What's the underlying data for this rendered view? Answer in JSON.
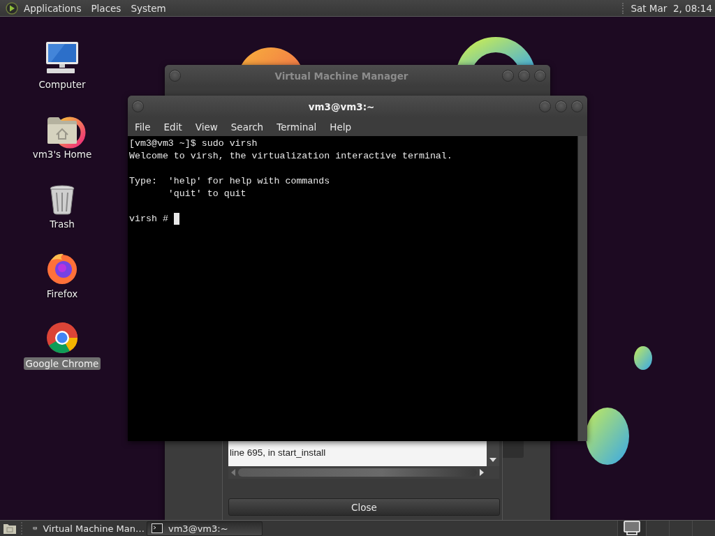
{
  "top_panel": {
    "menus": [
      {
        "label": "Applications"
      },
      {
        "label": "Places"
      },
      {
        "label": "System"
      }
    ],
    "clock": "Sat Mar  2, 08:14"
  },
  "desktop_icons": [
    {
      "label": "Computer",
      "kind": "computer",
      "selected": false
    },
    {
      "label": "vm3's Home",
      "kind": "home",
      "selected": false
    },
    {
      "label": "Trash",
      "kind": "trash",
      "selected": false
    },
    {
      "label": "Firefox",
      "kind": "firefox",
      "selected": false
    },
    {
      "label": "Google Chrome",
      "kind": "chrome",
      "selected": true
    }
  ],
  "vmm_window": {
    "title": "Virtual Machine Manager",
    "active": false
  },
  "error_dialog": {
    "text_lines": [
      "line 695, in start_install"
    ],
    "button": "Close"
  },
  "terminal": {
    "title": "vm3@vm3:~",
    "active": true,
    "menus": [
      {
        "label": "File"
      },
      {
        "label": "Edit"
      },
      {
        "label": "View"
      },
      {
        "label": "Search"
      },
      {
        "label": "Terminal"
      },
      {
        "label": "Help"
      }
    ],
    "lines": [
      {
        "text": "[vm3@vm3 ~]$ sudo virsh",
        "gap_before": false,
        "cursor": false
      },
      {
        "text": "Welcome to virsh, the virtualization interactive terminal.",
        "gap_before": false,
        "cursor": false
      },
      {
        "text": "Type:  'help' for help with commands",
        "gap_before": true,
        "cursor": false
      },
      {
        "text": "       'quit' to quit",
        "gap_before": false,
        "cursor": false
      },
      {
        "text": "virsh # ",
        "gap_before": true,
        "cursor": true
      }
    ]
  },
  "taskbar": {
    "tasks": [
      {
        "label": "Virtual Machine Man…",
        "kind": "vmm",
        "selected": false
      },
      {
        "label": "vm3@vm3:~",
        "kind": "terminal",
        "selected": true
      }
    ]
  }
}
